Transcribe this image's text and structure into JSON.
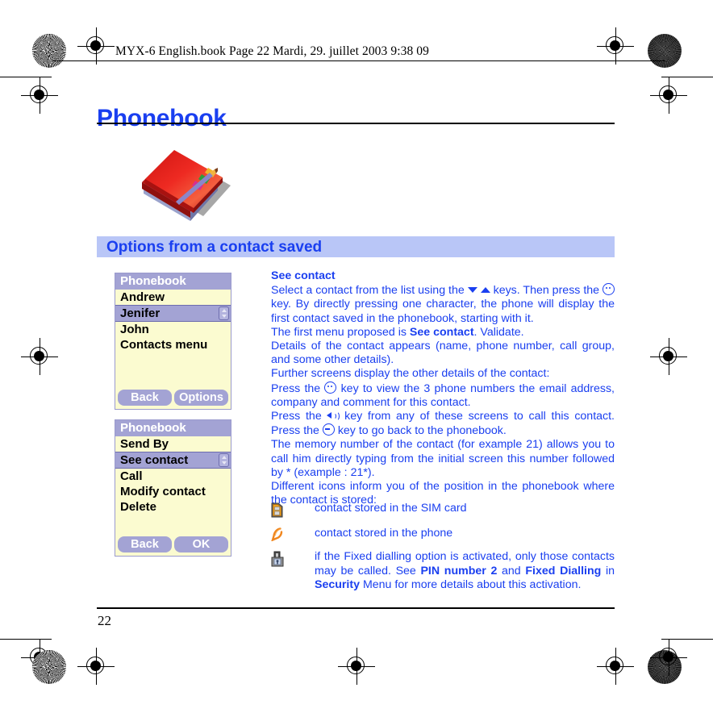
{
  "print_header": {
    "text": "MYX-6 English.book  Page 22  Mardi, 29. juillet 2003  9:38 09"
  },
  "page_title": "Phonebook",
  "illustration": {
    "name": "address-book-illustration",
    "colors": {
      "cover": "#e01b18",
      "cover_dark": "#a81210",
      "pages": "#b6bce0",
      "tab_yellow": "#f0b32a",
      "tab_green": "#2f9e3a",
      "tab_magenta": "#d62f8f",
      "shadow": "#808080"
    }
  },
  "section_banner": {
    "label": "Options from a contact saved",
    "background": "#b9c6f7",
    "text_color": "#1a3ff0"
  },
  "phone_screens": [
    {
      "name": "phonebook-contact-list",
      "title": "Phonebook",
      "rows": [
        {
          "label": "Andrew",
          "selected": false
        },
        {
          "label": "Jenifer",
          "selected": true
        },
        {
          "label": "John",
          "selected": false
        },
        {
          "label": "Contacts menu",
          "selected": false
        }
      ],
      "softkeys": {
        "left": "Back",
        "right": "Options"
      }
    },
    {
      "name": "phonebook-options-menu",
      "title": "Phonebook",
      "rows": [
        {
          "label": "Send By",
          "selected": false
        },
        {
          "label": "See contact",
          "selected": true
        },
        {
          "label": "Call",
          "selected": false
        },
        {
          "label": "Modify contact",
          "selected": false
        },
        {
          "label": "Delete",
          "selected": false
        }
      ],
      "softkeys": {
        "left": "Back",
        "right": "OK"
      }
    }
  ],
  "body": {
    "heading": "See contact",
    "p1_a": "Select a contact from the list using the ",
    "p1_b": " keys. Then press the ",
    "p1_c": " key. By directly pressing one character, the phone will display the first contact saved in the phonebook, starting with it.",
    "p2_a": "The first menu proposed is ",
    "p2_bold": "See contact",
    "p2_b": ". Validate.",
    "p3": "Details of the contact appears (name, phone number, call group, and some other details).",
    "p4": "Further screens display the other details of the contact:",
    "p5_a": "Press the ",
    "p5_b": " key to view the 3 phone numbers the email address, company and comment for this contact.",
    "p6_a": "Press the ",
    "p6_b": " key from any of these screens to call this contact. Press the ",
    "p6_c": " key to go back to the phonebook.",
    "p7": "The memory number of the contact (for example 21) allows you to call him directly typing from the initial screen this number followed by * (example : 21*).",
    "p8": "Different icons inform you of the position in the phonebook where the contact is stored:"
  },
  "icon_list": [
    {
      "icon": "sim-card-icon",
      "text": "contact stored in the SIM card"
    },
    {
      "icon": "phone-handset-icon",
      "text": "contact stored in the phone"
    },
    {
      "icon": "padlock-icon",
      "text_a": "if the Fixed dialling option is activated, only those contacts may be called. See ",
      "text_bold1": "PIN number 2",
      "text_b": " and ",
      "text_bold2": "Fixed Dialling",
      "text_c": " in ",
      "text_bold3": "Security",
      "text_d": " Menu for more details about this activation."
    }
  ],
  "page_number": "22",
  "colors": {
    "blue_text": "#1a3ff0",
    "screen_bg": "#fbfbd0",
    "screen_accent": "#a3a3d4"
  }
}
